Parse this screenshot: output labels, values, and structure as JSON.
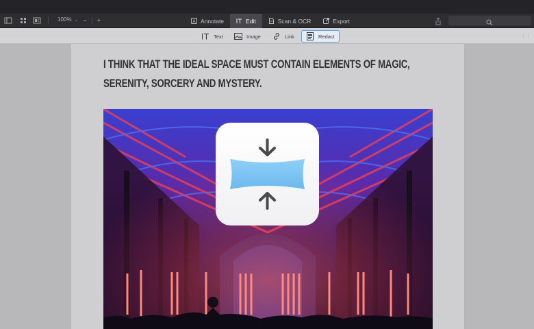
{
  "toolbar": {
    "zoom": "100%",
    "zoom_minus": "–",
    "zoom_plus": "+",
    "tabs": [
      {
        "label": "Annotate",
        "icon": "annotate-icon",
        "active": false
      },
      {
        "label": "Edit",
        "icon": "text-cursor-icon",
        "active": true
      },
      {
        "label": "Scan & OCR",
        "icon": "scan-icon",
        "active": false
      },
      {
        "label": "Export",
        "icon": "export-icon",
        "active": false
      }
    ]
  },
  "edit_tools": [
    {
      "label": "Text",
      "icon": "text-cursor-icon",
      "active": false
    },
    {
      "label": "Image",
      "icon": "image-icon",
      "active": false
    },
    {
      "label": "Link",
      "icon": "link-icon",
      "active": false
    },
    {
      "label": "Redact",
      "icon": "redact-icon",
      "active": true
    }
  ],
  "document": {
    "heading": "I think that the ideal space must contain elements of magic, serenity, sorcery and mystery."
  },
  "colors": {
    "titlebar": "#242428",
    "toolbar": "#2e2e31",
    "active_tab": "#48484c",
    "redact_highlight": "#6a9fd8",
    "compress_blue": "#7cc4f4"
  }
}
